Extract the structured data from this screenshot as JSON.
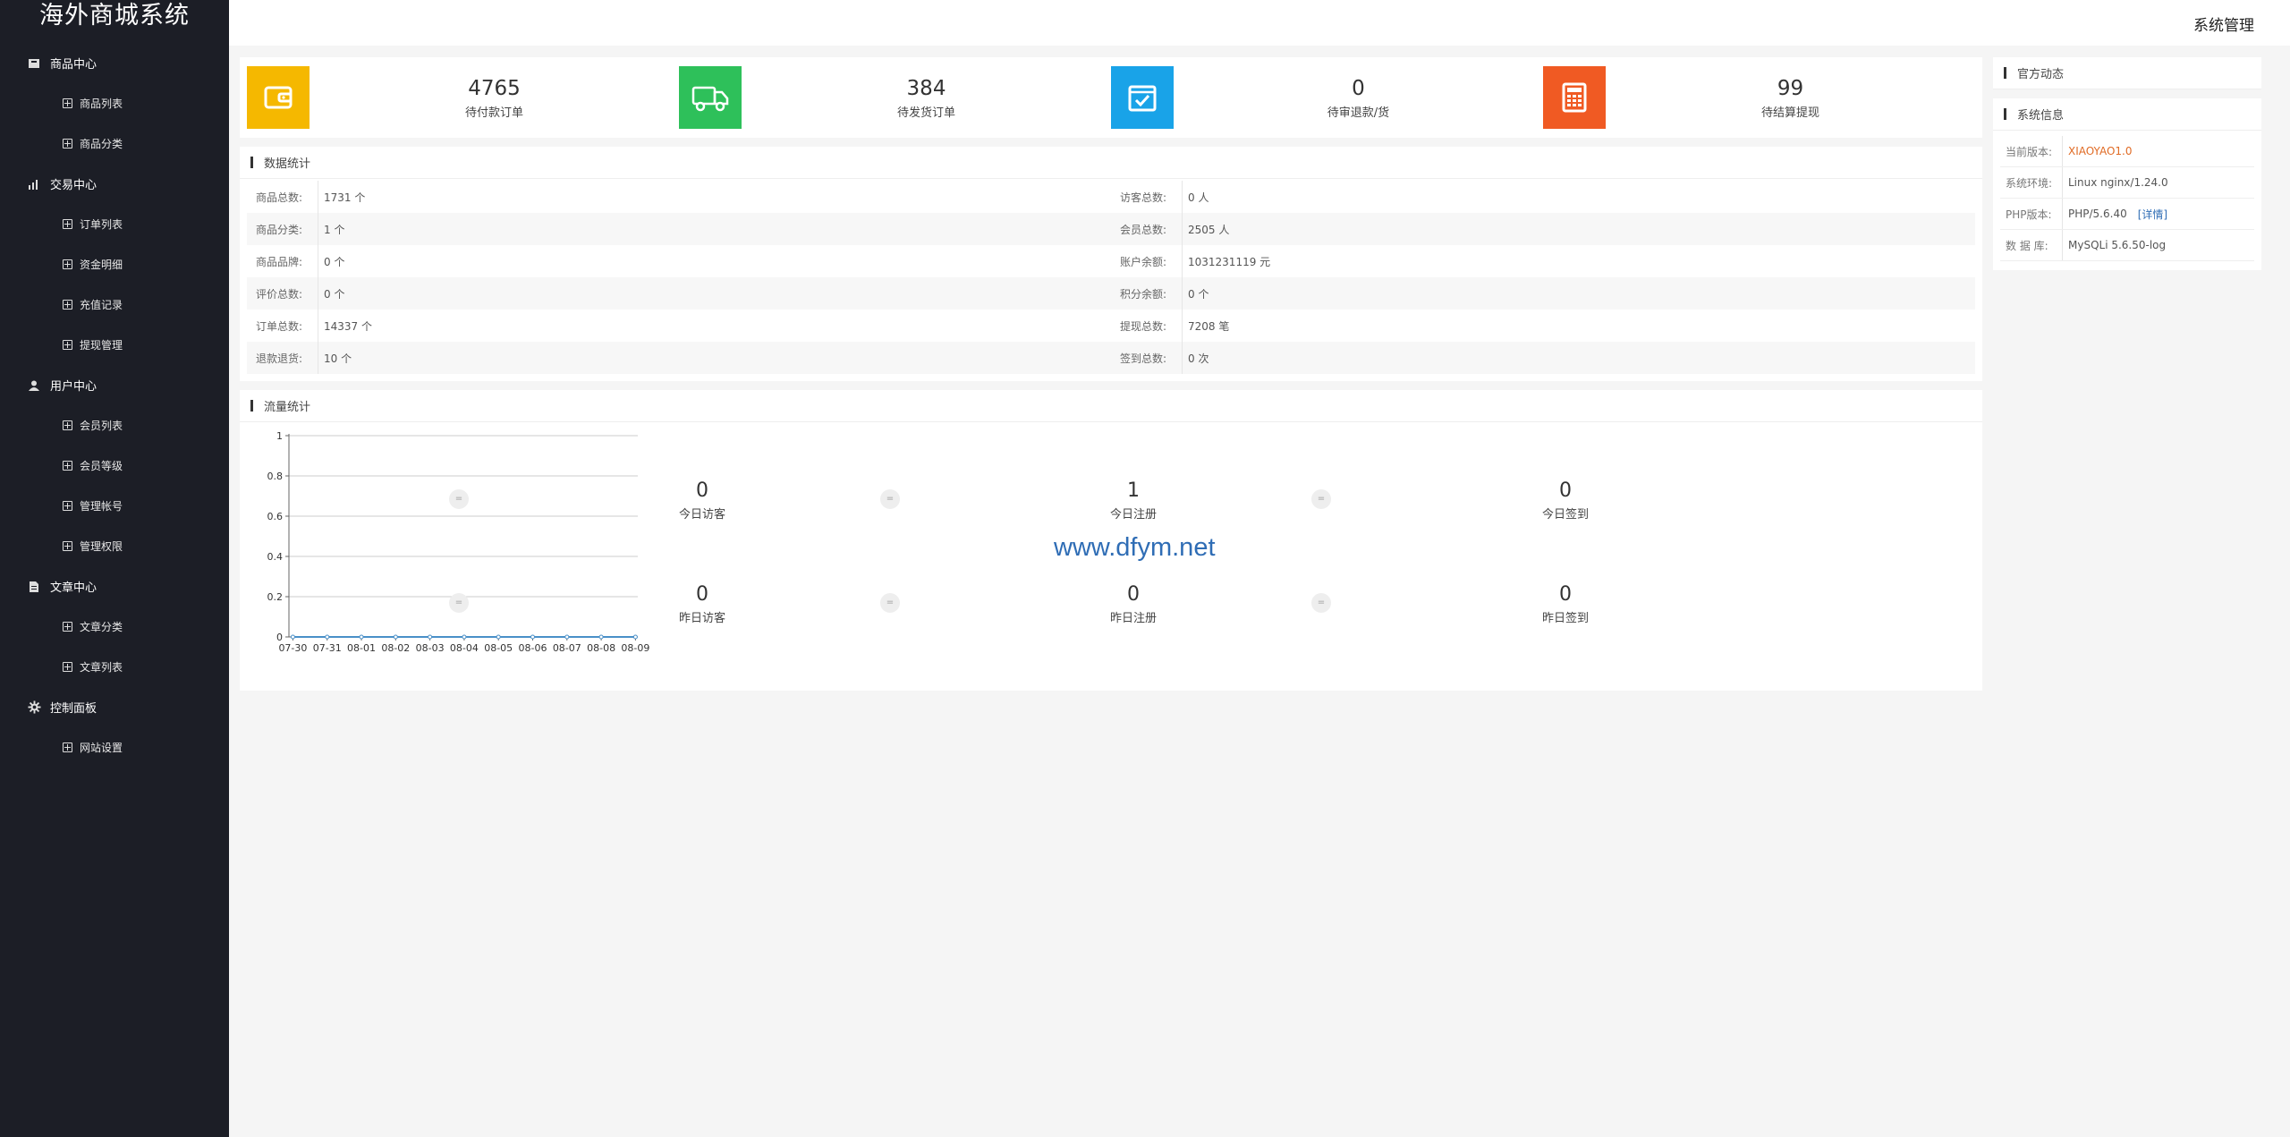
{
  "app_title": "海外商城系统",
  "header": {
    "right_label": "系统管理"
  },
  "sidebar": [
    {
      "label": "商品中心",
      "icon": "package-icon",
      "items": [
        "商品列表",
        "商品分类"
      ]
    },
    {
      "label": "交易中心",
      "icon": "bar-chart-icon",
      "items": [
        "订单列表",
        "资金明细",
        "充值记录",
        "提现管理"
      ]
    },
    {
      "label": "用户中心",
      "icon": "user-icon",
      "items": [
        "会员列表",
        "会员等级",
        "管理帐号",
        "管理权限"
      ]
    },
    {
      "label": "文章中心",
      "icon": "document-icon",
      "items": [
        "文章分类",
        "文章列表"
      ]
    },
    {
      "label": "控制面板",
      "icon": "gear-icon",
      "items": [
        "网站设置"
      ]
    }
  ],
  "stat_cards": [
    {
      "value": "4765",
      "label": "待付款订单",
      "color": "#f5b800",
      "icon": "wallet-icon"
    },
    {
      "value": "384",
      "label": "待发货订单",
      "color": "#2ec05a",
      "icon": "truck-icon"
    },
    {
      "value": "0",
      "label": "待审退款/货",
      "color": "#19a3e8",
      "icon": "box-check-icon"
    },
    {
      "value": "99",
      "label": "待结算提现",
      "color": "#f05a23",
      "icon": "calculator-icon"
    }
  ],
  "data_stats": {
    "title": "数据统计",
    "rows": [
      [
        {
          "k": "商品总数:",
          "v": "1731 个"
        },
        {
          "k": "访客总数:",
          "v": "0 人"
        }
      ],
      [
        {
          "k": "商品分类:",
          "v": "1 个"
        },
        {
          "k": "会员总数:",
          "v": "2505 人"
        }
      ],
      [
        {
          "k": "商品品牌:",
          "v": "0 个"
        },
        {
          "k": "账户余额:",
          "v": "1031231119 元"
        }
      ],
      [
        {
          "k": "评价总数:",
          "v": "0 个"
        },
        {
          "k": "积分余额:",
          "v": "0 个"
        }
      ],
      [
        {
          "k": "订单总数:",
          "v": "14337 个"
        },
        {
          "k": "提现总数:",
          "v": "7208 笔"
        }
      ],
      [
        {
          "k": "退款退货:",
          "v": "10 个"
        },
        {
          "k": "签到总数:",
          "v": "0 次"
        }
      ]
    ]
  },
  "flow_stats": {
    "title": "流量统计",
    "dot_symbol": "=",
    "kpis": [
      {
        "value": "0",
        "label": "今日访客"
      },
      {
        "value": "1",
        "label": "今日注册"
      },
      {
        "value": "0",
        "label": "今日签到"
      },
      {
        "value": "0",
        "label": "昨日访客"
      },
      {
        "value": "0",
        "label": "昨日注册"
      },
      {
        "value": "0",
        "label": "昨日签到"
      }
    ],
    "watermark": "www.dfym.net"
  },
  "chart_data": {
    "type": "line",
    "categories": [
      "07-30",
      "07-31",
      "08-01",
      "08-02",
      "08-03",
      "08-04",
      "08-05",
      "08-06",
      "08-07",
      "08-08",
      "08-09"
    ],
    "series": [
      {
        "values": [
          0,
          0,
          0,
          0,
          0,
          0,
          0,
          0,
          0,
          0,
          0
        ]
      }
    ],
    "ylim": [
      0,
      1
    ],
    "yticks": [
      "0",
      "0.2",
      "0.4",
      "0.6",
      "0.8",
      "1"
    ],
    "grid": true,
    "title": "",
    "xlabel": "",
    "ylabel": "",
    "series_color": "#4a90c8"
  },
  "official_news": {
    "title": "官方动态"
  },
  "system_info": {
    "title": "系统信息",
    "rows": [
      {
        "k": "当前版本:",
        "v": "XIAOYAO1.0",
        "highlight": true
      },
      {
        "k": "系统环境:",
        "v": "Linux nginx/1.24.0"
      },
      {
        "k": "PHP版本:",
        "v": "PHP/5.6.40",
        "link": "[详情]"
      },
      {
        "k": "数 据 库:",
        "v": "MySQLi 5.6.50-log"
      }
    ]
  }
}
